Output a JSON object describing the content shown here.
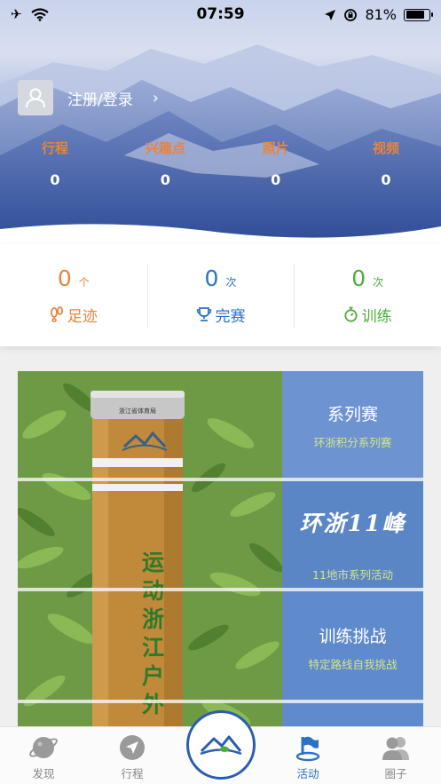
{
  "status_bar": {
    "time": "07:59",
    "battery_percent": "81%",
    "battery_level": 0.81,
    "icons": [
      "airplane-icon",
      "wifi-icon",
      "location-icon",
      "rotation-lock-icon",
      "battery-icon"
    ]
  },
  "profile": {
    "login_text": "注册/登录",
    "chevron": "›"
  },
  "stats": [
    {
      "label": "行程",
      "value": "0"
    },
    {
      "label": "兴趣点",
      "value": "0"
    },
    {
      "label": "照片",
      "value": "0"
    },
    {
      "label": "视频",
      "value": "0"
    }
  ],
  "summary": [
    {
      "count": "0",
      "unit": "个",
      "label": "足迹",
      "color": "#e8843e",
      "icon": "footprint-icon"
    },
    {
      "count": "0",
      "unit": "次",
      "label": "完赛",
      "color": "#2b72c7",
      "icon": "trophy-icon"
    },
    {
      "count": "0",
      "unit": "次",
      "label": "训练",
      "color": "#4caf3a",
      "icon": "stopwatch-icon"
    }
  ],
  "activities": {
    "post_text": "运动浙江 户外",
    "post_cap_text": "浙江省体育局",
    "panels": [
      {
        "title": "系列赛",
        "subtitle": "环浙积分系列赛"
      },
      {
        "brand": "环浙11峰",
        "subtitle": "11地市系列活动"
      },
      {
        "title": "训练挑战",
        "subtitle": "特定路线自我挑战"
      }
    ]
  },
  "tabbar": {
    "tabs": [
      {
        "label": "发现",
        "icon": "planet-icon"
      },
      {
        "label": "行程",
        "icon": "compass-arrow-icon"
      },
      {
        "label": "活动",
        "icon": "flag-icon",
        "active": true
      },
      {
        "label": "圈子",
        "icon": "people-icon"
      }
    ],
    "center_icon": "mountain-logo-icon",
    "active_color": "#2b72c7"
  }
}
